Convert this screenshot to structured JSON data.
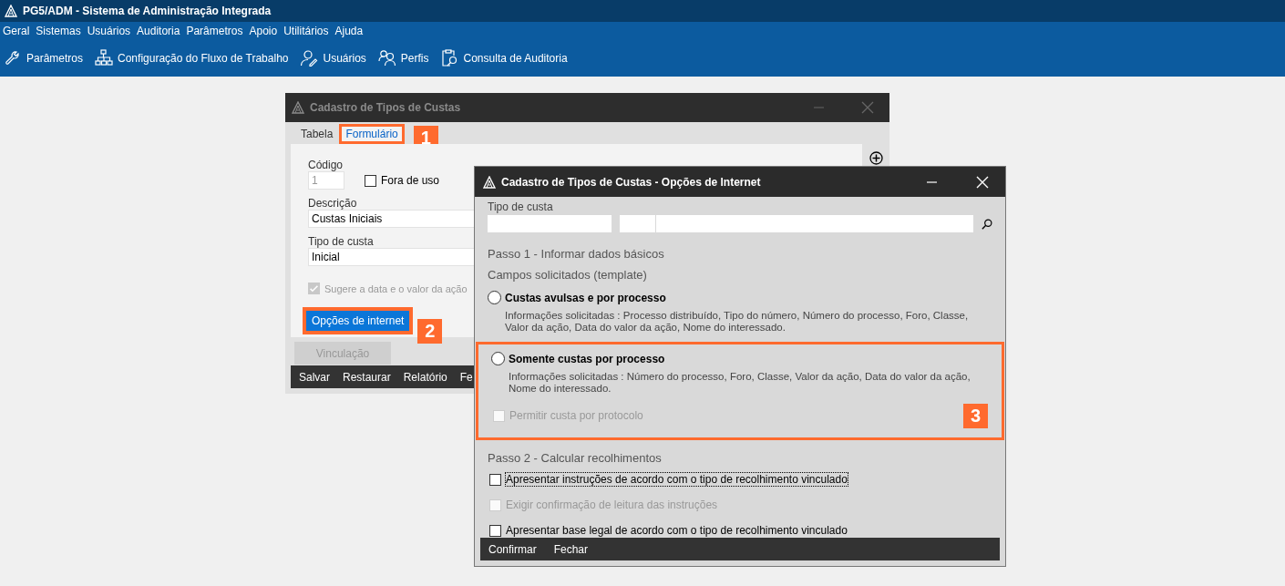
{
  "app": {
    "title": "PG5/ADM - Sistema de Administração Integrada"
  },
  "menu": [
    "Geral",
    "Sistemas",
    "Usuários",
    "Auditoria",
    "Parâmetros",
    "Apoio",
    "Utilitários",
    "Ajuda"
  ],
  "toolbar": [
    {
      "label": "Parâmetros",
      "kind": "wrench"
    },
    {
      "label": "Configuração do Fluxo de Trabalho",
      "kind": "hierarchy"
    },
    {
      "label": "Usuários",
      "kind": "user"
    },
    {
      "label": "Perfis",
      "kind": "users"
    },
    {
      "label": "Consulta de Auditoria",
      "kind": "audit"
    }
  ],
  "back_window": {
    "title": "Cadastro de Tipos de Custas",
    "tabs": [
      {
        "label": "Tabela",
        "selected": false
      },
      {
        "label": "Formulário",
        "selected": true,
        "callout": "1"
      }
    ],
    "codigo": {
      "label": "Código",
      "value": "1",
      "disabled": true
    },
    "fora_de_uso": {
      "label": "Fora de uso",
      "checked": false
    },
    "descricao": {
      "label": "Descrição",
      "value": "Custas Iniciais"
    },
    "tipo_de_custa": {
      "label": "Tipo de custa",
      "value": "Inicial"
    },
    "sugere": {
      "label": "Sugere a data e o valor da ação",
      "checked": true,
      "disabled": true
    },
    "internet_button": {
      "label": "Opções de internet",
      "callout": "2"
    },
    "vinculacao_button": {
      "label": "Vinculação",
      "disabled": true
    },
    "footer_buttons": [
      "Salvar",
      "Restaurar",
      "Relatório",
      "Fe"
    ]
  },
  "dialog": {
    "title": "Cadastro de Tipos de Custas - Opções de Internet",
    "tipo_de_custa_label": "Tipo de custa",
    "step1": "Passo 1 - Informar dados básicos",
    "campos": "Campos solicitados (template)",
    "options": [
      {
        "label": "Custas avulsas e por processo",
        "info": "Informações solicitadas : Processo distribuído, Tipo do número, Número do processo, Foro, Classe, Valor da ação, Data do valor da ação, Nome do interessado.",
        "selected": false
      },
      {
        "label": "Somente custas por processo",
        "info": "Informações solicitadas : Número do processo, Foro, Classe, Valor da ação, Data do valor da ação, Nome do interessado.",
        "selected": false,
        "callout": "3"
      }
    ],
    "permitir": {
      "label": "Permitir custa por protocolo",
      "checked": false,
      "disabled": true
    },
    "step2": "Passo 2 - Calcular recolhimentos",
    "checks": [
      {
        "label": "Apresentar instruções de acordo com o tipo de recolhimento vinculado",
        "checked": false,
        "disabled": false,
        "focused": true
      },
      {
        "label": "Exigir confirmação de leitura das instruções",
        "checked": false,
        "disabled": true,
        "focused": false
      },
      {
        "label": "Apresentar base legal de acordo com o tipo de recolhimento vinculado",
        "checked": false,
        "disabled": false,
        "focused": false
      }
    ],
    "buttons": [
      "Confirmar",
      "Fechar"
    ]
  }
}
